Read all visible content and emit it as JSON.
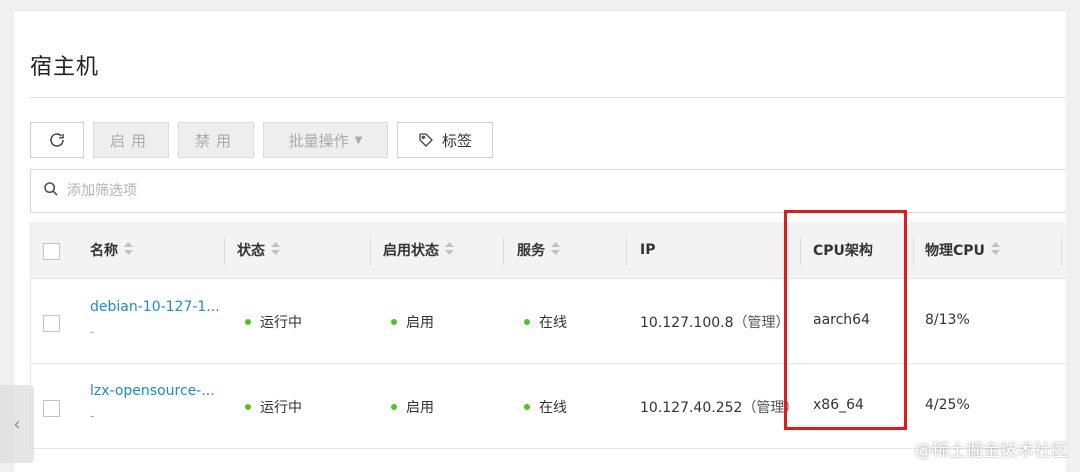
{
  "page": {
    "title": "宿主机"
  },
  "toolbar": {
    "refresh_icon": "refresh-icon",
    "enable_label": "启用",
    "disable_label": "禁用",
    "batch_label": "批量操作",
    "tag_label": "标签"
  },
  "search": {
    "placeholder": "添加筛选项"
  },
  "table": {
    "headers": {
      "name": "名称",
      "status": "状态",
      "enable_status": "启用状态",
      "service": "服务",
      "ip": "IP",
      "cpu_arch": "CPU架构",
      "physical_cpu": "物理CPU"
    },
    "rows": [
      {
        "name": "debian-10-127-1...",
        "sub": "-",
        "status": "运行中",
        "enable_status": "启用",
        "service": "在线",
        "ip": "10.127.100.8",
        "ip_note": "（管理）",
        "cpu_arch": "aarch64",
        "physical_cpu": "8/13%"
      },
      {
        "name": "lzx-opensource-...",
        "sub": "-",
        "status": "运行中",
        "enable_status": "启用",
        "service": "在线",
        "ip": "10.127.40.252",
        "ip_note": "（管理）",
        "cpu_arch": "x86_64",
        "physical_cpu": "4/25%"
      }
    ]
  },
  "colors": {
    "accent_link": "#1a8ad1",
    "status_green": "#52c41a",
    "highlight_red": "#e11b1b"
  },
  "watermark": "@稀土掘金技术社区"
}
